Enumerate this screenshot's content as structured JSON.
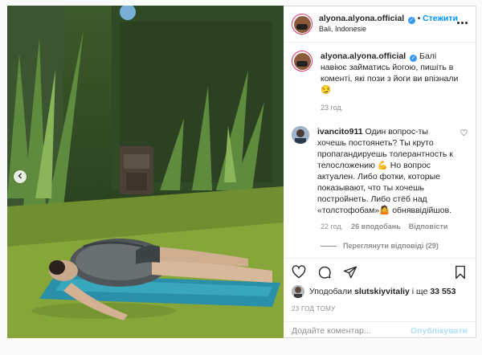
{
  "header": {
    "username": "alyona.alyona.official",
    "separator": "•",
    "follow_label": "Стежити",
    "location": "Bali, Indonesie"
  },
  "caption": {
    "username": "alyona.alyona.official",
    "text": "Балі навіює займатись йогою, пишіть в коменті, які пози з йоги ви впізнали😏",
    "time": "23 год."
  },
  "comment": {
    "username": "ivancito911",
    "text": "Один вопрос-ты хочешь постоянеть? Ты круто пропагандируешь толерантность к телосложению 💪 Но вопрос актуален. Либо фотки, которые показывают, что ты хочешь постройнеть. Либо стёб над «толстофобам»🤷 обняввідійшов.",
    "time": "22 год.",
    "likes": "26 вподобань",
    "reply": "Відповісти",
    "view_replies": "Переглянути відповіді (29)"
  },
  "likes": {
    "prefix": "Уподобали",
    "user": "slutskiyvitaliy",
    "middle": "і ще",
    "count": "33 553"
  },
  "posted": "23 ГОД ТОМУ",
  "add_comment": {
    "placeholder": "Додайте коментар...",
    "publish_label": "Опублікувати"
  },
  "icons": [
    "chevron-left-icon",
    "more-icon",
    "verified-icon",
    "heart-icon",
    "comment-icon",
    "share-icon",
    "bookmark-icon"
  ]
}
